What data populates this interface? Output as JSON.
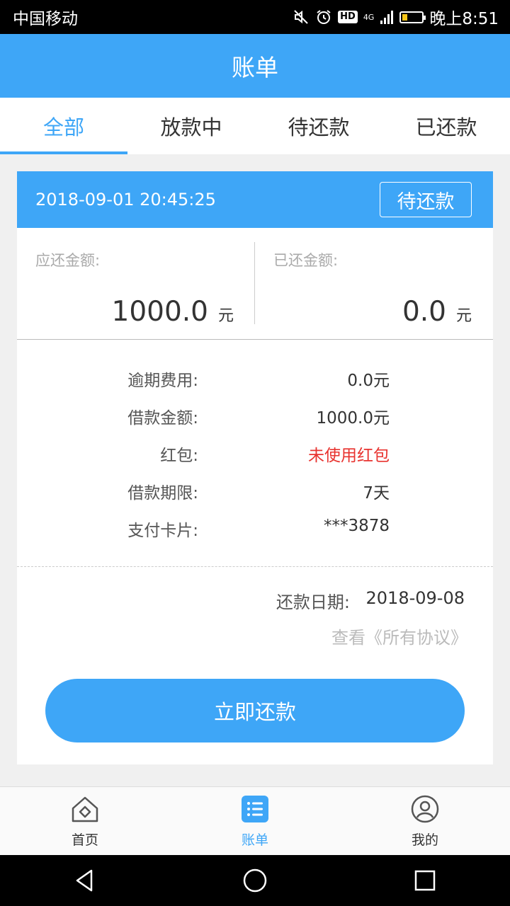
{
  "status_bar": {
    "carrier": "中国移动",
    "hd_label": "HD",
    "network_label": "4G",
    "time": "晚上8:51",
    "battery_level": 0.25
  },
  "header": {
    "title": "账单"
  },
  "tabs": [
    {
      "label": "全部",
      "active": true
    },
    {
      "label": "放款中",
      "active": false
    },
    {
      "label": "待还款",
      "active": false
    },
    {
      "label": "已还款",
      "active": false
    }
  ],
  "bill": {
    "datetime": "2018-09-01 20:45:25",
    "status": "待还款",
    "due_amount": {
      "label": "应还金额:",
      "value": "1000.0",
      "unit": "元"
    },
    "paid_amount": {
      "label": "已还金额:",
      "value": "0.0",
      "unit": "元"
    },
    "details": [
      {
        "label": "逾期费用:",
        "value": "0.0元",
        "highlight": false
      },
      {
        "label": "借款金额:",
        "value": "1000.0元",
        "highlight": false
      },
      {
        "label": "红包:",
        "value": "未使用红包",
        "highlight": true
      },
      {
        "label": "借款期限:",
        "value": "7天",
        "highlight": false
      },
      {
        "label": "支付卡片:",
        "value": "***3878",
        "highlight": false
      }
    ],
    "due_date": {
      "label": "还款日期:",
      "value": "2018-09-08"
    },
    "agreement_link": "查看《所有协议》",
    "pay_button": "立即还款"
  },
  "bottom_nav": [
    {
      "label": "首页",
      "icon": "home-icon",
      "active": false
    },
    {
      "label": "账单",
      "icon": "bill-list-icon",
      "active": true
    },
    {
      "label": "我的",
      "icon": "profile-icon",
      "active": false
    }
  ],
  "system_nav": [
    "back-icon",
    "home-circle-icon",
    "recents-icon"
  ],
  "colors": {
    "primary": "#3ea6f7",
    "warning_red": "#e8332f"
  }
}
